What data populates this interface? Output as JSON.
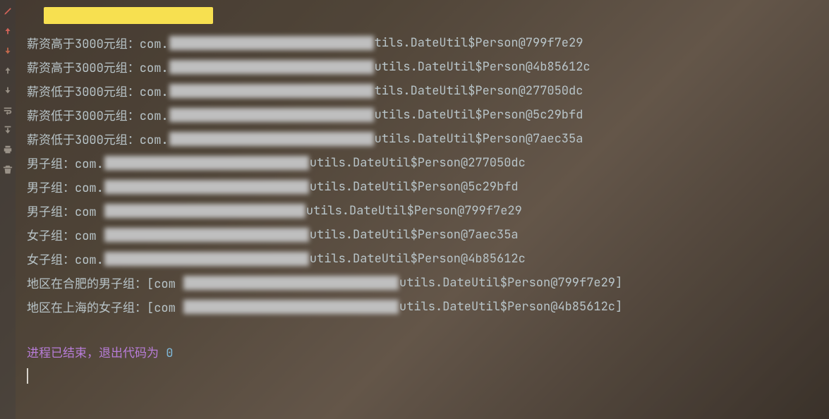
{
  "sidebar": {
    "icons": [
      "edit",
      "up-red",
      "down",
      "up",
      "down2",
      "wrap",
      "dl",
      "print",
      "trash"
    ]
  },
  "lines": [
    {
      "prefix": "薪资高于3000元组：com.",
      "redactedWidth": 290,
      "suffix": "tils.DateUtil$Person@799f7e29"
    },
    {
      "prefix": "薪资高于3000元组：com.",
      "redactedWidth": 290,
      "suffix": "utils.DateUtil$Person@4b85612c"
    },
    {
      "prefix": "薪资低于3000元组：com.",
      "redactedWidth": 290,
      "suffix": "tils.DateUtil$Person@277050dc"
    },
    {
      "prefix": "薪资低于3000元组：com.",
      "redactedWidth": 290,
      "suffix": "utils.DateUtil$Person@5c29bfd"
    },
    {
      "prefix": "薪资低于3000元组：com.",
      "redactedWidth": 290,
      "suffix": "utils.DateUtil$Person@7aec35a"
    },
    {
      "prefix": "男子组：com.",
      "redactedWidth": 290,
      "suffix": "utils.DateUtil$Person@277050dc"
    },
    {
      "prefix": "男子组：com.",
      "redactedWidth": 290,
      "suffix": "utils.DateUtil$Person@5c29bfd"
    },
    {
      "prefix": "男子组：com ",
      "redactedWidth": 285,
      "suffix": "utils.DateUtil$Person@799f7e29"
    },
    {
      "prefix": "女子组：com ",
      "redactedWidth": 290,
      "suffix": "utils.DateUtil$Person@7aec35a"
    },
    {
      "prefix": "女子组：com.",
      "redactedWidth": 290,
      "suffix": "utils.DateUtil$Person@4b85612c"
    },
    {
      "prefix": "地区在合肥的男子组：[com ",
      "redactedWidth": 305,
      "suffix": "utils.DateUtil$Person@799f7e29]"
    },
    {
      "prefix": "地区在上海的女子组：[com ",
      "redactedWidth": 305,
      "suffix": "utils.DateUtil$Person@4b85612c]"
    }
  ],
  "exit": {
    "text": "进程已结束，退出代码为 ",
    "code": "0"
  }
}
